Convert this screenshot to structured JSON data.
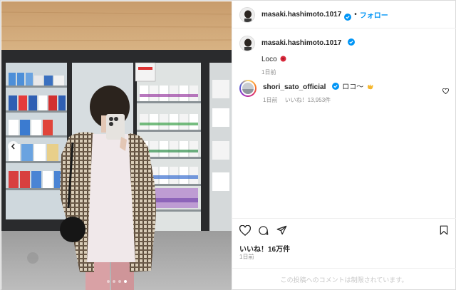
{
  "post": {
    "author": "masaki.hashimoto.1017",
    "follow_label": "フォロー",
    "caption_user": "masaki.hashimoto.1017",
    "caption_text": "Loco",
    "caption_age": "1日前",
    "comment": {
      "user": "shori_sato_official",
      "text": "ロコ〜",
      "age": "1日前",
      "likes": "いいね！13,953件"
    },
    "likes": "いいね！16万件",
    "date": "1日前",
    "comments_disabled": "この投稿へのコメントは制限されています。"
  },
  "carousel": {
    "count": 4,
    "active_index": 3
  },
  "colors": {
    "verified": "#0095f6",
    "follow": "#0095f6",
    "text": "#262626",
    "muted": "#8e8e8e"
  },
  "icons": [
    "verified-icon",
    "heart-icon",
    "comment-icon",
    "share-icon",
    "bookmark-icon",
    "chevron-left-icon",
    "rose-emoji-icon",
    "hand-emoji-icon"
  ]
}
